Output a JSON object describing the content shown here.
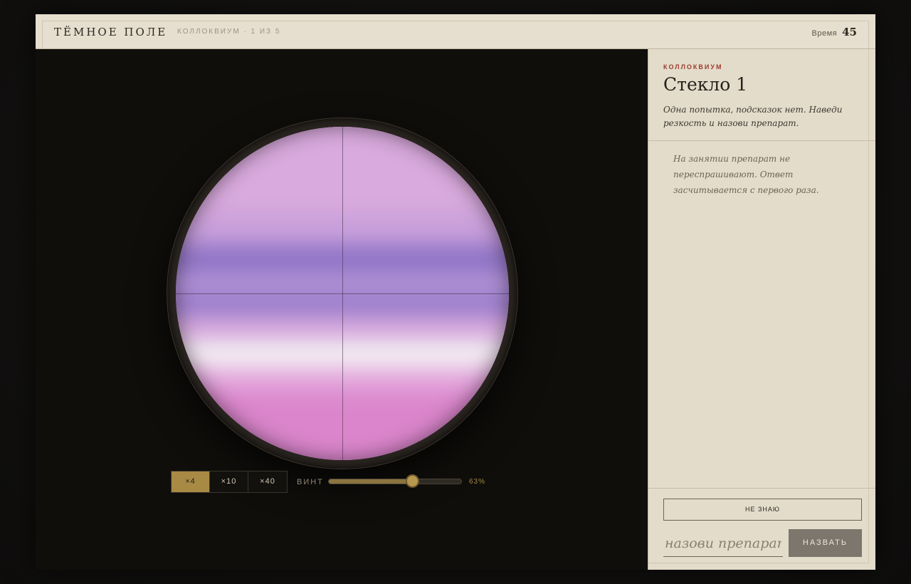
{
  "header": {
    "brand": "ТЁМНОЕ ПОЛЕ",
    "session": "КОЛЛОКВИУМ · 1 ИЗ 5",
    "timer_label": "Время",
    "timer_value": "45"
  },
  "microscope": {
    "magnifications": [
      {
        "label": "×4",
        "active": true
      },
      {
        "label": "×10",
        "active": false
      },
      {
        "label": "×40",
        "active": false
      }
    ],
    "focus_label": "ВИНТ",
    "focus_value": "63%",
    "focus_fraction": 0.63,
    "stain_colors": [
      "#d7a9dc",
      "#8e72c2",
      "#f2ecf2",
      "#dc7fc6"
    ]
  },
  "panel": {
    "eyebrow": "КОЛЛОКВИУМ",
    "title": "Стекло 1",
    "intro": "Одна попытка, подсказок нет. Наведи резкость и назови препарат.",
    "note": "На занятии препарат не переспрашивают. Ответ засчитывается с первого раза.",
    "dont_know_label": "НЕ ЗНАЮ",
    "answer_placeholder": "назови препарат...",
    "submit_label": "НАЗВАТЬ"
  }
}
